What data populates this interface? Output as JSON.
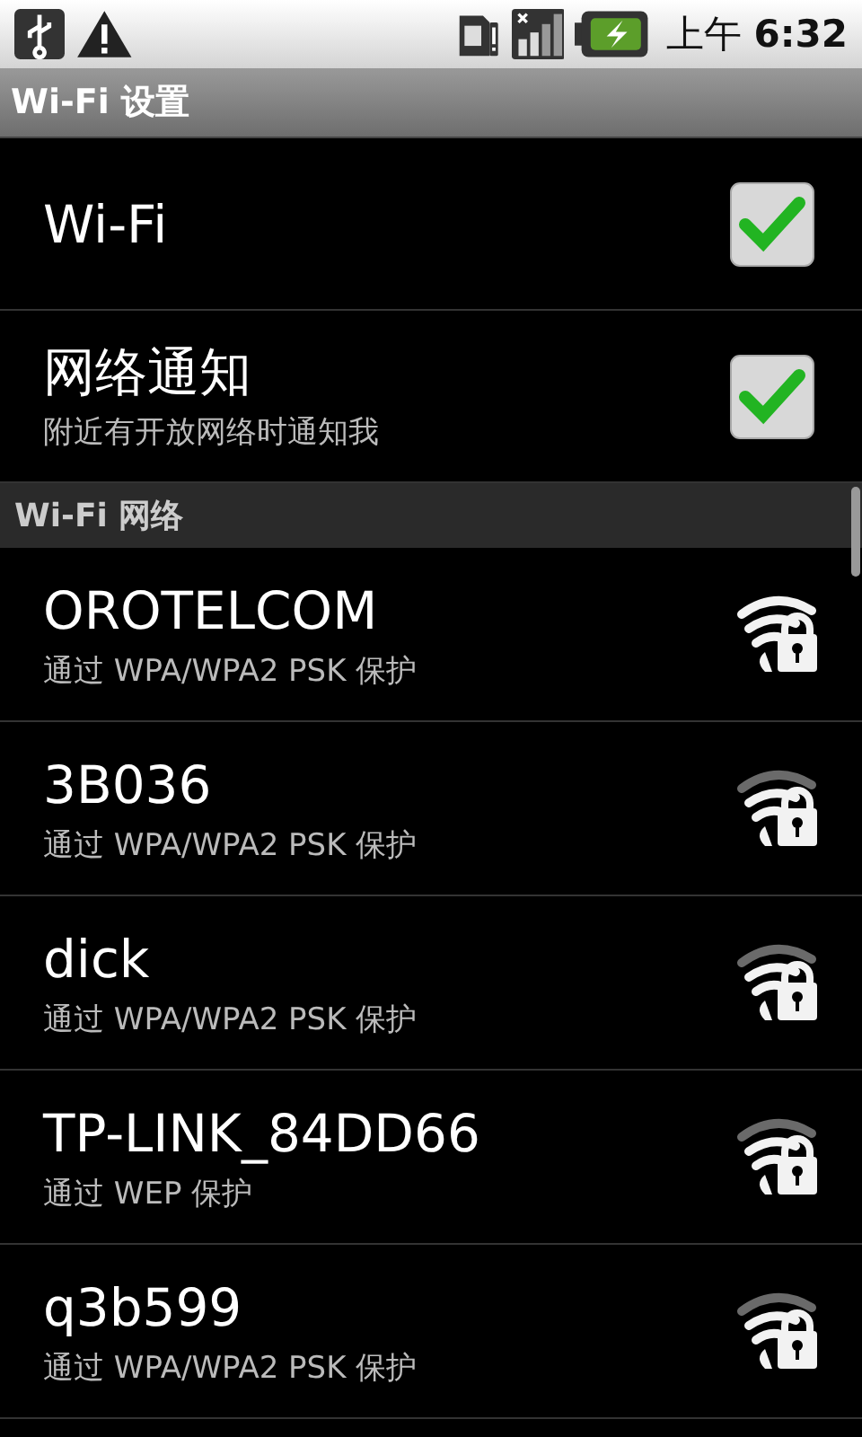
{
  "status_bar": {
    "time_prefix": "上午",
    "time": "6:32"
  },
  "title": "Wi-Fi 设置",
  "settings": [
    {
      "label": "Wi-Fi",
      "checked": true
    },
    {
      "label": "网络通知",
      "summary": "附近有开放网络时通知我",
      "checked": true
    }
  ],
  "section": "Wi-Fi 网络",
  "networks": [
    {
      "name": "OROTELCOM",
      "security": "通过 WPA/WPA2 PSK 保护",
      "kind": "strong"
    },
    {
      "name": "3B036",
      "security": "通过 WPA/WPA2 PSK 保护",
      "kind": "good"
    },
    {
      "name": "dick",
      "security": "通过 WPA/WPA2 PSK 保护",
      "kind": "good"
    },
    {
      "name": "TP-LINK_84DD66",
      "security": "通过 WEP 保护",
      "kind": "good"
    },
    {
      "name": "q3b599",
      "security": "通过 WPA/WPA2 PSK 保护",
      "kind": "good"
    }
  ]
}
